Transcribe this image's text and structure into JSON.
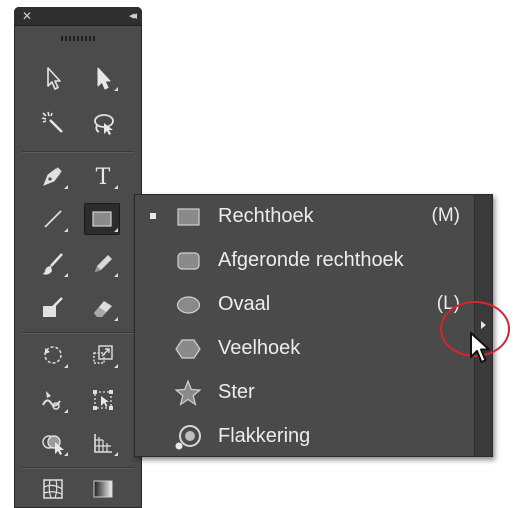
{
  "toolbar": {
    "close_glyph": "✕",
    "collapse_glyph": "◂◂",
    "tools": [
      {
        "id": "selection",
        "icon": "selection-arrow-icon"
      },
      {
        "id": "direct-selection",
        "icon": "direct-selection-arrow-icon"
      },
      {
        "id": "magic-wand",
        "icon": "magic-wand-icon"
      },
      {
        "id": "lasso",
        "icon": "lasso-icon"
      },
      {
        "id": "pen",
        "icon": "pen-icon"
      },
      {
        "id": "type",
        "icon": "type-icon",
        "glyph": "T"
      },
      {
        "id": "line",
        "icon": "line-segment-icon"
      },
      {
        "id": "rectangle",
        "icon": "rectangle-icon",
        "active": true
      },
      {
        "id": "paintbrush",
        "icon": "paintbrush-icon"
      },
      {
        "id": "pencil",
        "icon": "pencil-icon"
      },
      {
        "id": "blob-brush",
        "icon": "blob-brush-icon"
      },
      {
        "id": "eraser",
        "icon": "eraser-icon"
      },
      {
        "id": "rotate",
        "icon": "rotate-icon"
      },
      {
        "id": "scale",
        "icon": "scale-icon"
      },
      {
        "id": "warp",
        "icon": "warp-icon"
      },
      {
        "id": "free-transform",
        "icon": "free-transform-icon"
      },
      {
        "id": "shape-builder",
        "icon": "shape-builder-icon"
      },
      {
        "id": "perspective-grid",
        "icon": "perspective-grid-icon"
      },
      {
        "id": "mesh",
        "icon": "mesh-icon"
      },
      {
        "id": "gradient",
        "icon": "gradient-icon"
      }
    ]
  },
  "flyout": {
    "items": [
      {
        "label": "Rechthoek",
        "shortcut": "(M)",
        "icon": "rectangle-icon",
        "selected": true
      },
      {
        "label": "Afgeronde rechthoek",
        "shortcut": "",
        "icon": "rounded-rectangle-icon",
        "selected": false
      },
      {
        "label": "Ovaal",
        "shortcut": "(L)",
        "icon": "ellipse-icon",
        "selected": false
      },
      {
        "label": "Veelhoek",
        "shortcut": "",
        "icon": "polygon-icon",
        "selected": false
      },
      {
        "label": "Ster",
        "shortcut": "",
        "icon": "star-icon",
        "selected": false
      },
      {
        "label": "Flakkering",
        "shortcut": "",
        "icon": "flare-icon",
        "selected": false
      }
    ],
    "tearoff_icon": "tearoff-arrow-icon"
  },
  "colors": {
    "panel_bg": "#4b4b4b",
    "flyout_bg": "#4a4a4a",
    "text": "#ececec",
    "annotation": "#d82330"
  }
}
